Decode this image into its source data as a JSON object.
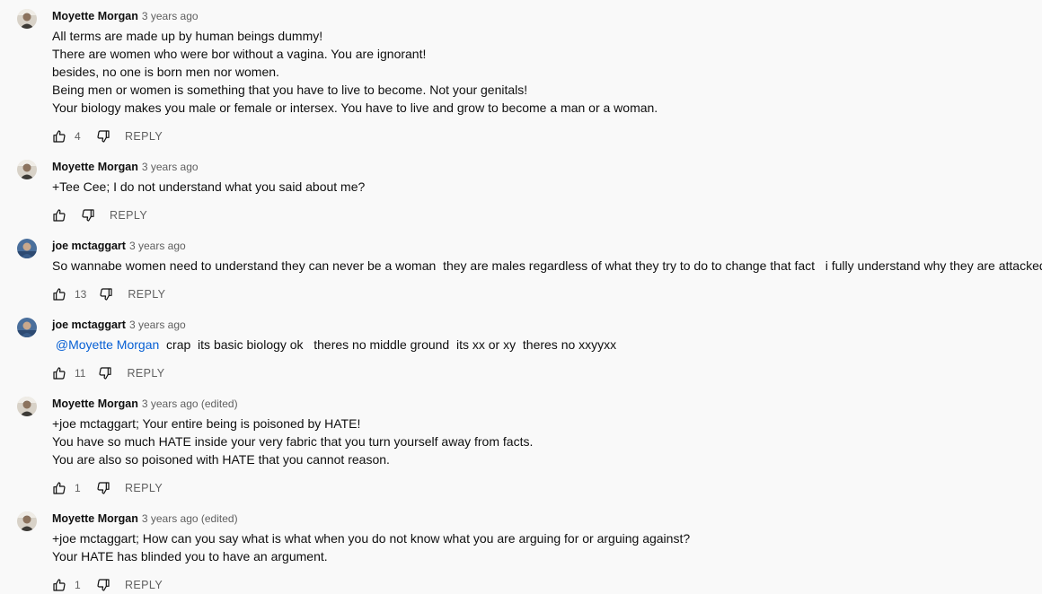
{
  "comments": [
    {
      "author": "Moyette Morgan",
      "avatar": "person-avatar-dark",
      "time": "3 years ago",
      "lines": [
        [
          {
            "t": "All terms are made up by human beings dummy!"
          }
        ],
        [
          {
            "t": "There are women who were bor without a vagina. You are ignorant!"
          }
        ],
        [
          {
            "t": "besides, no one is born men nor women."
          }
        ],
        [
          {
            "t": "Being men or women is something that you have to live to become. Not your genitals!"
          }
        ],
        [
          {
            "t": "Your biology makes you male or female or intersex. You have to live and grow to become a man or a woman."
          }
        ]
      ],
      "likes": "4",
      "reply_label": "REPLY"
    },
    {
      "author": "Moyette Morgan",
      "avatar": "person-avatar-dark",
      "time": "3 years ago",
      "lines": [
        [
          {
            "t": "+Tee Cee; I do not understand what you said about me?"
          }
        ]
      ],
      "likes": "",
      "reply_label": "REPLY"
    },
    {
      "author": "joe mctaggart",
      "avatar": "person-avatar-blue",
      "time": "3 years ago",
      "lines": [
        [
          {
            "t": "So wannabe women need to understand they can never be a woman  they are males regardless of what they try to do to change that fact   i fully understand why they are attacked"
          }
        ]
      ],
      "likes": "13",
      "reply_label": "REPLY"
    },
    {
      "author": "joe mctaggart",
      "avatar": "person-avatar-blue",
      "time": "3 years ago",
      "lines": [
        [
          {
            "t": " "
          },
          {
            "t": "@Moyette Morgan",
            "mention": true
          },
          {
            "t": "  crap  its basic biology ok   theres no middle ground  its xx or xy  theres no xxyyxx"
          }
        ]
      ],
      "likes": "11",
      "reply_label": "REPLY"
    },
    {
      "author": "Moyette Morgan",
      "avatar": "person-avatar-dark",
      "time": "3 years ago (edited)",
      "lines": [
        [
          {
            "t": "+joe mctaggart; Your entire being is poisoned by HATE!"
          }
        ],
        [
          {
            "t": "You have so much HATE inside your very fabric that you turn yourself away from facts."
          }
        ],
        [
          {
            "t": "You are also so poisoned with HATE that you cannot reason."
          }
        ]
      ],
      "likes": "1",
      "reply_label": "REPLY"
    },
    {
      "author": "Moyette Morgan",
      "avatar": "person-avatar-dark",
      "time": "3 years ago (edited)",
      "lines": [
        [
          {
            "t": "+joe mctaggart; How can you say what is what when you do not know what you are arguing for or arguing against?"
          }
        ],
        [
          {
            "t": "Your HATE has blinded you to have an argument."
          }
        ]
      ],
      "likes": "1",
      "reply_label": "REPLY"
    }
  ],
  "icons": {
    "like": "thumbs-up-icon",
    "dislike": "thumbs-down-icon"
  },
  "colors": {
    "background": "#f9f9f9",
    "text": "#0f0f0f",
    "secondary_text": "#606060",
    "mention": "#065fd4"
  }
}
